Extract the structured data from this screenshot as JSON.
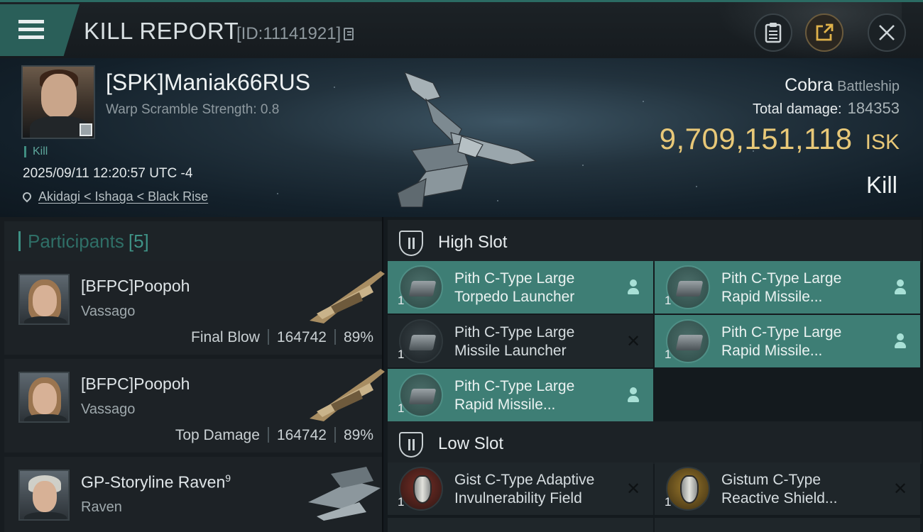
{
  "header": {
    "title": "KILL REPORT",
    "report_id": "[ID:11141921]"
  },
  "victim": {
    "name": "[SPK]Maniak66RUS",
    "warp_scramble": "Warp Scramble Strength: 0.8",
    "tag": "Kill",
    "datetime": "2025/09/11 12:20:57 UTC -4",
    "location": "Akidagi < Ishaga < Black Rise",
    "ship": "Cobra",
    "ship_class": "Battleship",
    "total_damage_label": "Total damage:",
    "total_damage_value": "184353",
    "isk_value": "9,709,151,118",
    "isk_unit": "ISK",
    "result": "Kill"
  },
  "participants": {
    "title": "Participants",
    "count": "[5]",
    "items": [
      {
        "name": "[BFPC]Poopoh",
        "sup": "",
        "ship": "Vassago",
        "role": "Final Blow",
        "damage": "164742",
        "percent": "89%"
      },
      {
        "name": "[BFPC]Poopoh",
        "sup": "",
        "ship": "Vassago",
        "role": "Top Damage",
        "damage": "164742",
        "percent": "89%"
      },
      {
        "name": "GP-Storyline Raven",
        "sup": "9",
        "ship": "Raven",
        "role": "",
        "damage": "",
        "percent": ""
      }
    ]
  },
  "fitting": {
    "high_slot": {
      "title": "High Slot",
      "modules": [
        {
          "line1": "Pith C-Type Large",
          "line2": "Torpedo Launcher",
          "qty": "1",
          "state": "active"
        },
        {
          "line1": "Pith C-Type Large",
          "line2": "Rapid Missile...",
          "qty": "1",
          "state": "active"
        },
        {
          "line1": "Pith C-Type Large",
          "line2": "Missile Launcher",
          "qty": "1",
          "state": "destroyed"
        },
        {
          "line1": "Pith C-Type Large",
          "line2": "Rapid Missile...",
          "qty": "1",
          "state": "active"
        },
        {
          "line1": "Pith C-Type Large",
          "line2": "Rapid Missile...",
          "qty": "1",
          "state": "active"
        }
      ]
    },
    "low_slot": {
      "title": "Low Slot",
      "modules": [
        {
          "line1": "Gist C-Type Adaptive",
          "line2": "Invulnerability Field",
          "qty": "1",
          "state": "destroyed"
        },
        {
          "line1": "Gistum C-Type",
          "line2": "Reactive Shield...",
          "qty": "1",
          "state": "destroyed"
        }
      ]
    }
  },
  "icons": [
    "menu-icon",
    "copy-icon",
    "clipboard-icon",
    "share-icon",
    "close-icon",
    "location-pin-icon",
    "pilot-dropped-icon",
    "module-destroyed-icon",
    "high-slot-icon",
    "low-slot-icon"
  ],
  "colors": {
    "accent": "#3e7e75",
    "isk": "#e8c878",
    "background": "#14191e"
  }
}
